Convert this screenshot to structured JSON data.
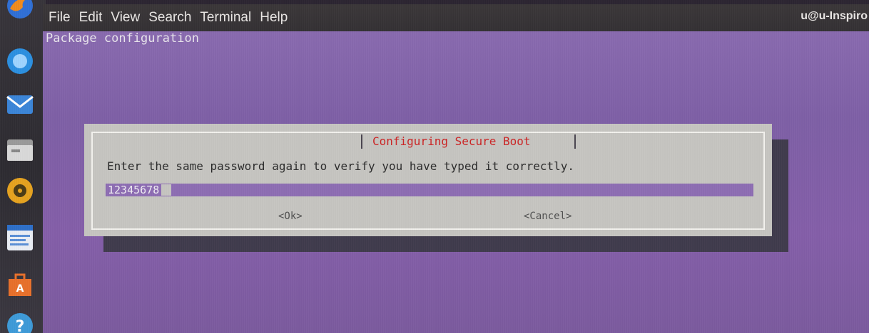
{
  "menubar": {
    "items": [
      "File",
      "Edit",
      "View",
      "Search",
      "Terminal",
      "Help"
    ],
    "window_title": "u@u-Inspiro"
  },
  "terminal": {
    "header_text": "Package configuration"
  },
  "dialog": {
    "title": "Configuring Secure Boot",
    "message": "Enter the same password again to verify you have typed it correctly.",
    "password_value": "12345678",
    "ok_label": "<Ok>",
    "cancel_label": "<Cancel>"
  },
  "dock": {
    "icons": [
      "firefox-icon",
      "thunderbird-icon",
      "files-icon",
      "rhythmbox-icon",
      "writer-icon",
      "software-icon",
      "help-icon"
    ]
  },
  "colors": {
    "terminal_bg": "#8163a8",
    "dialog_bg": "#c6c5c1",
    "dialog_title": "#cc2424",
    "input_bg": "#8d6db3",
    "menubar_bg": "#363235"
  }
}
